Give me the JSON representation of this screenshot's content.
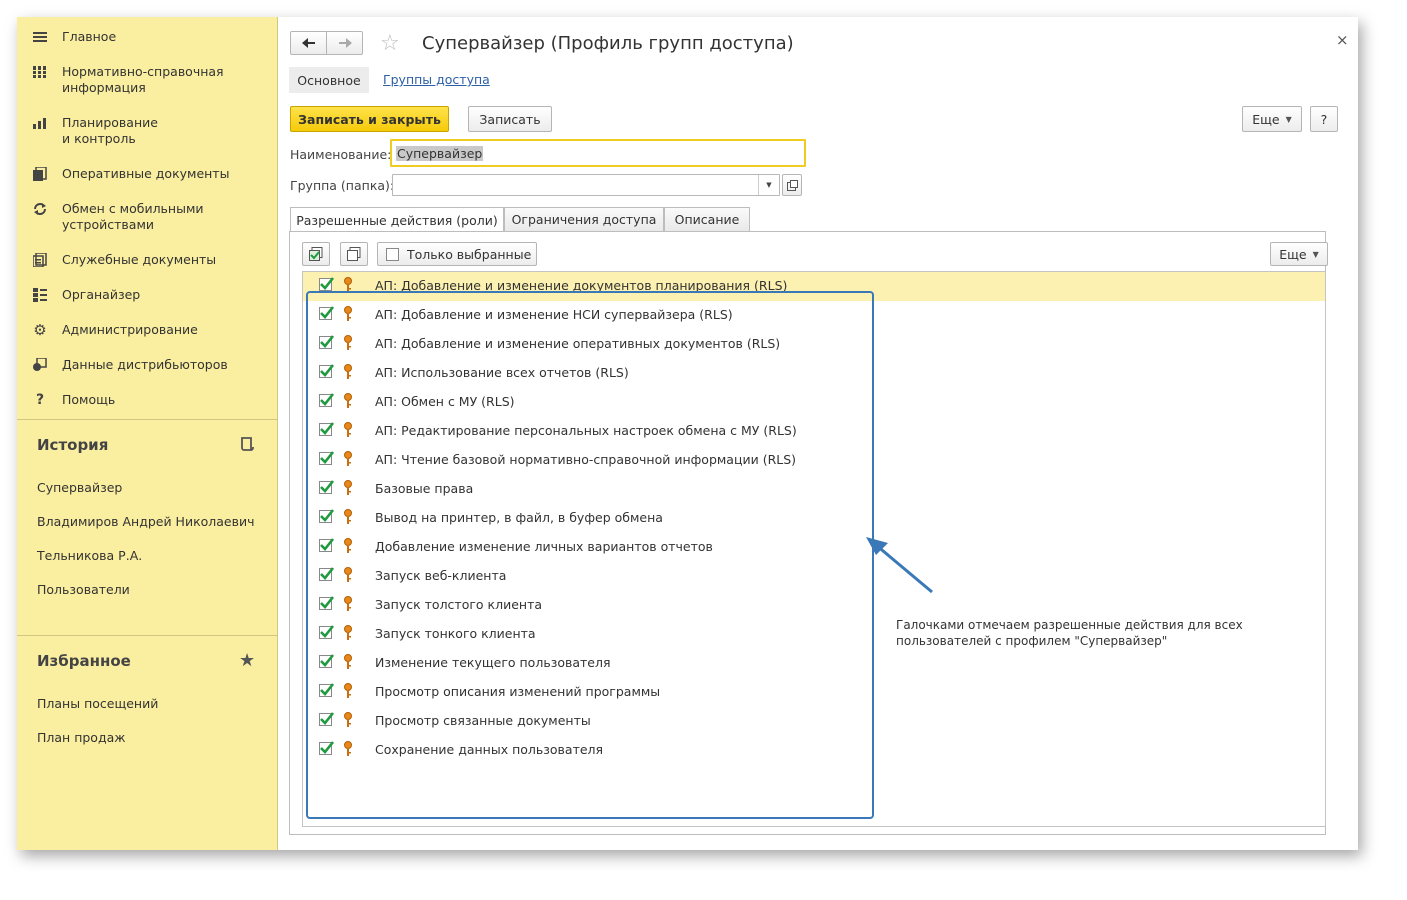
{
  "sidebar": {
    "nav": [
      {
        "icon": "menu-icon",
        "label": "Главное"
      },
      {
        "icon": "grid-icon",
        "label": "Нормативно-справочная информация"
      },
      {
        "icon": "chart-icon",
        "label": "Планирование и контроль"
      },
      {
        "icon": "documents-icon",
        "label": "Оперативные документы"
      },
      {
        "icon": "sync-icon",
        "label": "Обмен с мобильными устройствами"
      },
      {
        "icon": "service-docs-icon",
        "label": "Служебные документы"
      },
      {
        "icon": "organizer-icon",
        "label": "Органайзер"
      },
      {
        "icon": "gear-icon",
        "label": "Администрирование"
      },
      {
        "icon": "distributors-icon",
        "label": "Данные дистрибьюторов"
      },
      {
        "icon": "help-icon",
        "label": "Помощь"
      }
    ],
    "history": {
      "title": "История",
      "items": [
        "Супервайзер",
        "Владимиров Андрей Николаевич",
        "Тельникова Р.А.",
        "Пользователи"
      ]
    },
    "favorites": {
      "title": "Избранное",
      "items": [
        "Планы посещений",
        "План продаж"
      ]
    }
  },
  "header": {
    "title": "Супервайзер (Профиль групп доступа)",
    "close": "×",
    "subtabs": [
      "Основное",
      "Группы доступа"
    ]
  },
  "toolbar": {
    "save_close": "Записать и закрыть",
    "save": "Записать",
    "more": "Еще",
    "help": "?"
  },
  "form": {
    "name_label": "Наименование:",
    "name_value": "Супервайзер",
    "group_label": "Группа (папка):",
    "group_value": ""
  },
  "tabs": [
    "Разрешенные действия (роли)",
    "Ограничения доступа",
    "Описание"
  ],
  "list_toolbar": {
    "only_selected": "Только выбранные",
    "more": "Еще"
  },
  "roles": [
    {
      "label": "АП: Добавление и изменение документов планирования (RLS)",
      "checked": true
    },
    {
      "label": "АП: Добавление и изменение НСИ супервайзера (RLS)",
      "checked": true
    },
    {
      "label": "АП: Добавление и изменение оперативных документов (RLS)",
      "checked": true
    },
    {
      "label": "АП: Использование всех отчетов (RLS)",
      "checked": true
    },
    {
      "label": "АП: Обмен с МУ (RLS)",
      "checked": true
    },
    {
      "label": "АП: Редактирование персональных настроек обмена с МУ (RLS)",
      "checked": true
    },
    {
      "label": "АП: Чтение базовой нормативно-справочной информации (RLS)",
      "checked": true
    },
    {
      "label": "Базовые права",
      "checked": true
    },
    {
      "label": "Вывод на принтер, в файл, в буфер обмена",
      "checked": true
    },
    {
      "label": "Добавление изменение личных вариантов отчетов",
      "checked": true
    },
    {
      "label": "Запуск веб-клиента",
      "checked": true
    },
    {
      "label": "Запуск толстого клиента",
      "checked": true
    },
    {
      "label": "Запуск тонкого клиента",
      "checked": true
    },
    {
      "label": "Изменение текущего пользователя",
      "checked": true
    },
    {
      "label": "Просмотр описания изменений программы",
      "checked": true
    },
    {
      "label": "Просмотр связанные документы",
      "checked": true
    },
    {
      "label": "Сохранение данных пользователя",
      "checked": true
    }
  ],
  "annotation": "Галочками отмечаем разрешенные действия для всех пользователей с профилем \"Супервайзер\"",
  "colors": {
    "sidebar_bg": "#faeea0",
    "primary_btn": "#f6cb0a",
    "selected_row": "#fcf1b0",
    "frame": "#3a78b8",
    "check": "#1f9a3f"
  }
}
